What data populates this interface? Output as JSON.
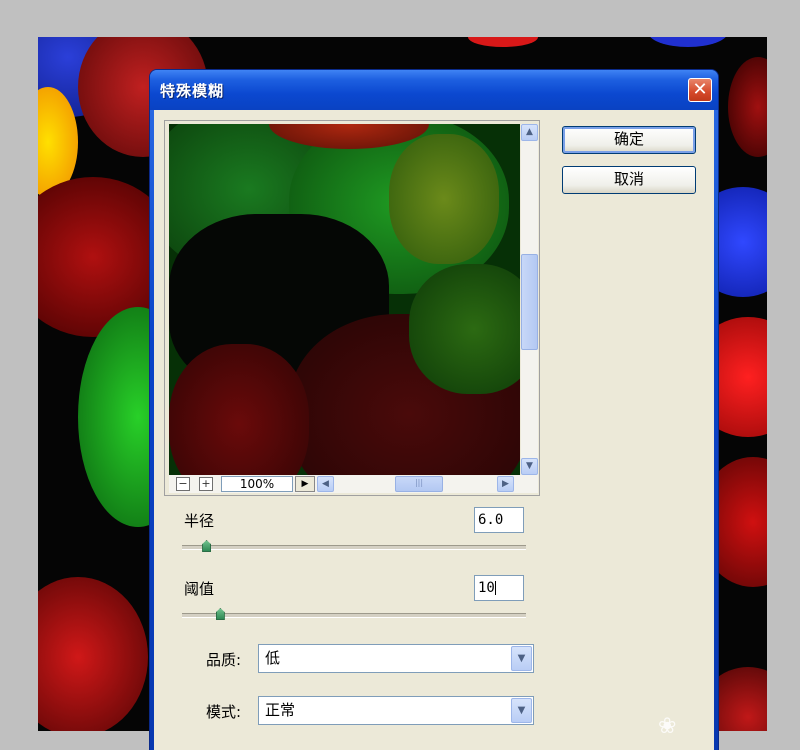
{
  "dialog": {
    "title": "特殊模糊",
    "close_glyph": "✕"
  },
  "buttons": {
    "ok_label": "确定",
    "cancel_label": "取消"
  },
  "preview": {
    "zoom_out_glyph": "−",
    "zoom_in_glyph": "+",
    "zoom_value": "100%",
    "scroll_up_glyph": "▲",
    "scroll_down_glyph": "▼",
    "scroll_left_glyph": "◀",
    "scroll_right_glyph": "▶",
    "zoom_menu_glyph": "▶",
    "grip_glyph": "|||"
  },
  "params": {
    "radius": {
      "label": "半径",
      "value": "6.0",
      "slider_fraction": 0.07
    },
    "threshold": {
      "label": "阈值",
      "value": "10",
      "slider_fraction": 0.11
    },
    "quality": {
      "label": "品质:",
      "value": "低"
    },
    "mode": {
      "label": "模式:",
      "value": "正常"
    },
    "combo_glyph": "▼"
  },
  "icons": {
    "paw": "paw-icon"
  },
  "colors": {
    "titlebar": "#0b48d0",
    "client": "#ece9d8",
    "close": "#d5492a"
  }
}
